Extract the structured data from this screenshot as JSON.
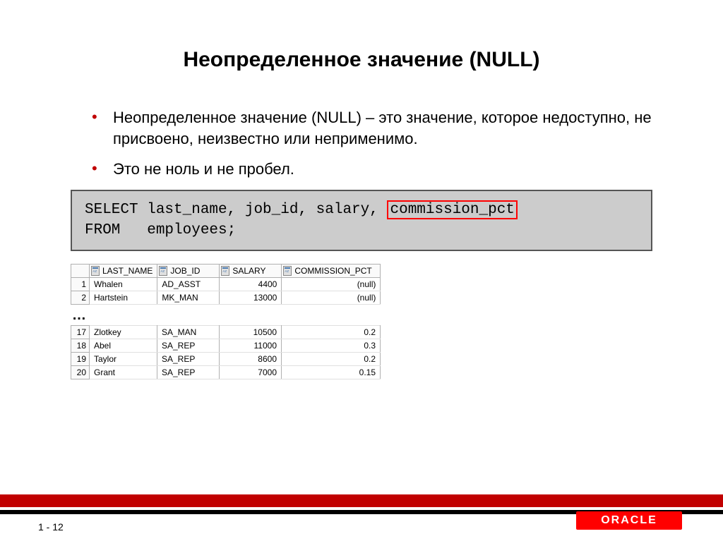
{
  "title": "Неопределенное значение (NULL)",
  "bullets": [
    "Неопределенное значение (NULL) – это значение, которое недоступно, не присвоено, неизвестно или неприменимо.",
    "Это не ноль и не пробел."
  ],
  "code": {
    "line1_pre": "SELECT last_name, job_id, salary, ",
    "line1_hl": "commission_pct",
    "line2": "FROM   employees;"
  },
  "table1": {
    "headers": [
      "LAST_NAME",
      "JOB_ID",
      "SALARY",
      "COMMISSION_PCT"
    ],
    "rows": [
      {
        "n": "1",
        "last_name": "Whalen",
        "job_id": "AD_ASST",
        "salary": "4400",
        "commission_pct": "(null)"
      },
      {
        "n": "2",
        "last_name": "Hartstein",
        "job_id": "MK_MAN",
        "salary": "13000",
        "commission_pct": "(null)"
      }
    ]
  },
  "ellipsis": "…",
  "table2": {
    "rows": [
      {
        "n": "17",
        "last_name": "Zlotkey",
        "job_id": "SA_MAN",
        "salary": "10500",
        "commission_pct": "0.2"
      },
      {
        "n": "18",
        "last_name": "Abel",
        "job_id": "SA_REP",
        "salary": "11000",
        "commission_pct": "0.3"
      },
      {
        "n": "19",
        "last_name": "Taylor",
        "job_id": "SA_REP",
        "salary": "8600",
        "commission_pct": "0.2"
      },
      {
        "n": "20",
        "last_name": "Grant",
        "job_id": "SA_REP",
        "salary": "7000",
        "commission_pct": "0.15"
      }
    ]
  },
  "logo": "ORACLE",
  "slide_number": "1 - 12",
  "col_widths": {
    "rownum": "26px",
    "last_name": "96px",
    "job_id": "88px",
    "salary": "88px",
    "commission_pct": "140px"
  }
}
